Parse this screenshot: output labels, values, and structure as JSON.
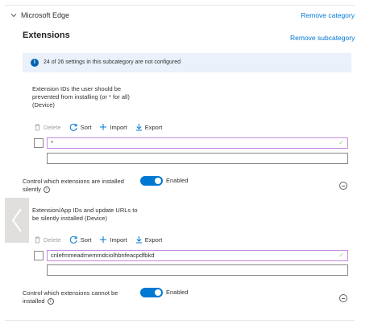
{
  "section": {
    "title": "Microsoft Edge",
    "remove_category": "Remove category"
  },
  "subcategory": {
    "title": "Extensions",
    "remove_subcategory": "Remove subcategory"
  },
  "info_message": "24 of 26 settings in this subcategory are not configured",
  "setting1": {
    "label_line1": "Extension IDs the user should be",
    "label_line2": "prevented from installing (or * for all)",
    "label_line3": "(Device)",
    "toolbar": {
      "delete": "Delete",
      "sort": "Sort",
      "import": "Import",
      "export": "Export"
    },
    "value": "*",
    "new_value": ""
  },
  "setting2": {
    "label_line1": "Control which extensions are installed",
    "label_line2": "silently",
    "toggle_label": "Enabled",
    "toggle_on": true
  },
  "setting3": {
    "label_line1": "Extension/App IDs and update URLs to",
    "label_line2": "be silently installed (Device)",
    "toolbar": {
      "delete": "Delete",
      "sort": "Sort",
      "import": "Import",
      "export": "Export"
    },
    "value": "cnlefmmeadmemmdciolhbnfeacpdfbkd",
    "new_value": ""
  },
  "setting4": {
    "label_line1": "Control which extensions cannot be",
    "label_line2": "installed",
    "toggle_label": "Enabled",
    "toggle_on": true
  },
  "colors": {
    "accent": "#0078d4",
    "info_bg": "#eaf1fb",
    "active_input_border": "#c68ae0"
  },
  "icons": [
    "chevron-down-icon",
    "info-icon",
    "trash-icon",
    "sort-icon",
    "plus-icon",
    "export-icon",
    "check-icon",
    "minus-circle-icon",
    "chevron-left-icon"
  ]
}
